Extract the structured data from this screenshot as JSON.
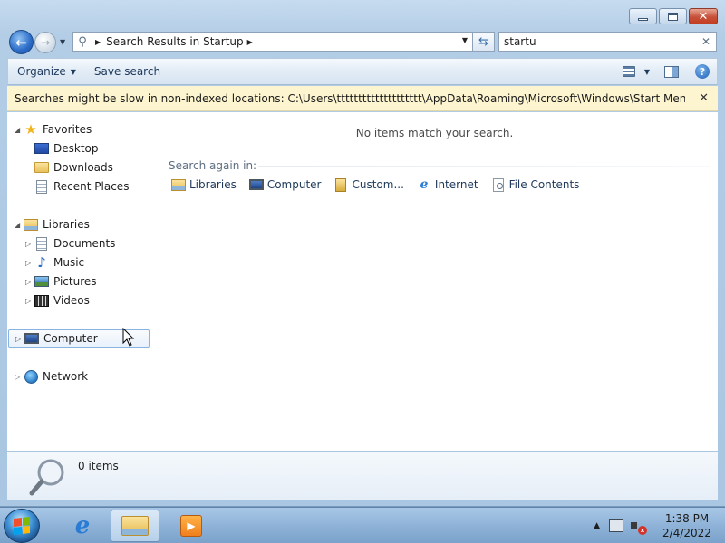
{
  "window": {
    "minimize_label": "",
    "maximize_label": "",
    "close_label": "✕"
  },
  "address_bar": {
    "breadcrumb": "Search Results in Startup",
    "search_value": "startu",
    "search_clear": "✕"
  },
  "toolbar": {
    "organize_label": "Organize",
    "save_search_label": "Save search"
  },
  "info_bar": {
    "message": "Searches might be slow in non-indexed locations: C:\\Users\\tttttttttttttttttttt\\AppData\\Roaming\\Microsoft\\Windows\\Start Menu\\Programs\\...",
    "close": "✕"
  },
  "nav_pane": {
    "favorites": {
      "label": "Favorites",
      "items": [
        {
          "label": "Desktop",
          "icon": "desktop-icon"
        },
        {
          "label": "Downloads",
          "icon": "downloads-folder-icon"
        },
        {
          "label": "Recent Places",
          "icon": "recent-places-icon"
        }
      ]
    },
    "libraries": {
      "label": "Libraries",
      "items": [
        {
          "label": "Documents",
          "icon": "documents-icon"
        },
        {
          "label": "Music",
          "icon": "music-icon"
        },
        {
          "label": "Pictures",
          "icon": "pictures-icon"
        },
        {
          "label": "Videos",
          "icon": "videos-icon"
        }
      ]
    },
    "computer": {
      "label": "Computer",
      "selected": true
    },
    "network": {
      "label": "Network"
    }
  },
  "results": {
    "empty_message": "No items match your search.",
    "search_again_label": "Search again in:",
    "search_again_locations": [
      {
        "label": "Libraries",
        "icon": "libraries-icon"
      },
      {
        "label": "Computer",
        "icon": "computer-icon"
      },
      {
        "label": "Custom...",
        "icon": "custom-icon"
      },
      {
        "label": "Internet",
        "icon": "internet-explorer-icon"
      },
      {
        "label": "File Contents",
        "icon": "file-contents-icon"
      }
    ]
  },
  "details_pane": {
    "item_count": "0 items"
  },
  "taskbar": {
    "clock_time": "1:38 PM",
    "clock_date": "2/4/2022"
  },
  "colors": {
    "info_bar_bg": "#fdf5cf",
    "selection_border": "#89b3e1",
    "close_button": "#c7513a"
  }
}
